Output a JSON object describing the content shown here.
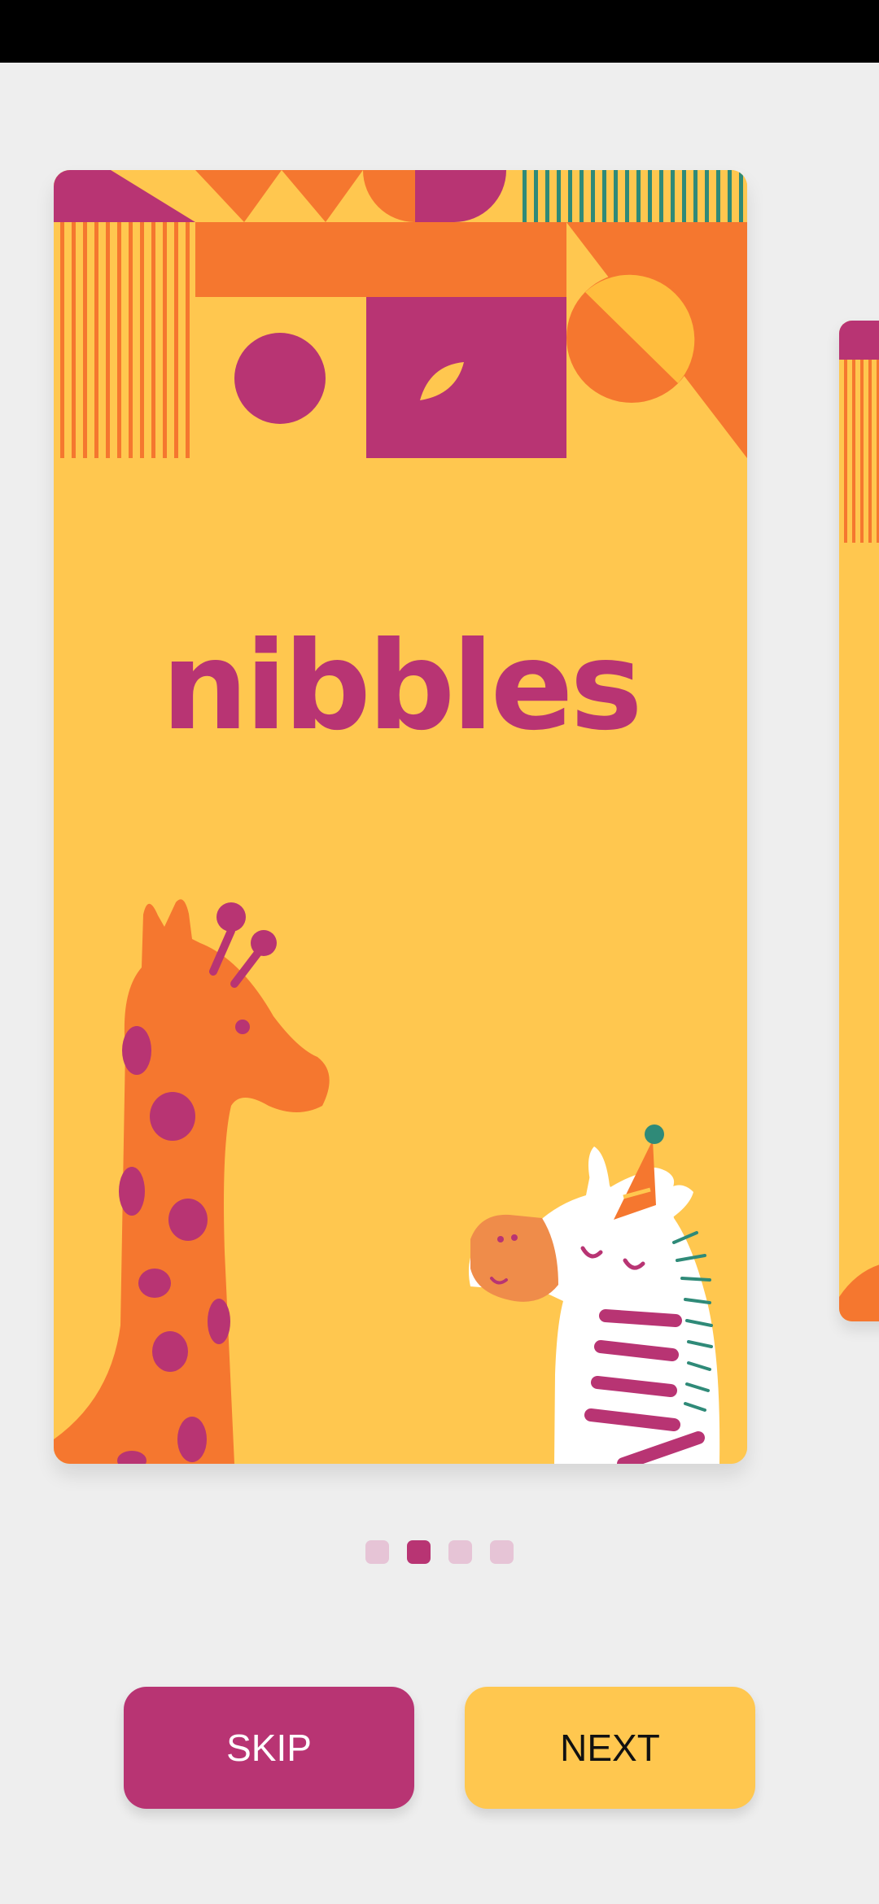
{
  "app": {
    "brand_name": "nibbles"
  },
  "onboarding": {
    "pages_total": 4,
    "current_page": 2
  },
  "buttons": {
    "skip_label": "SKIP",
    "next_label": "NEXT"
  },
  "colors": {
    "primary": "#b83473",
    "accent_yellow": "#ffc74f",
    "accent_orange": "#f5772f",
    "background": "#eeeeee"
  },
  "illustrations": {
    "pattern": "geometric-pattern",
    "animals": [
      "giraffe",
      "zebra"
    ]
  }
}
